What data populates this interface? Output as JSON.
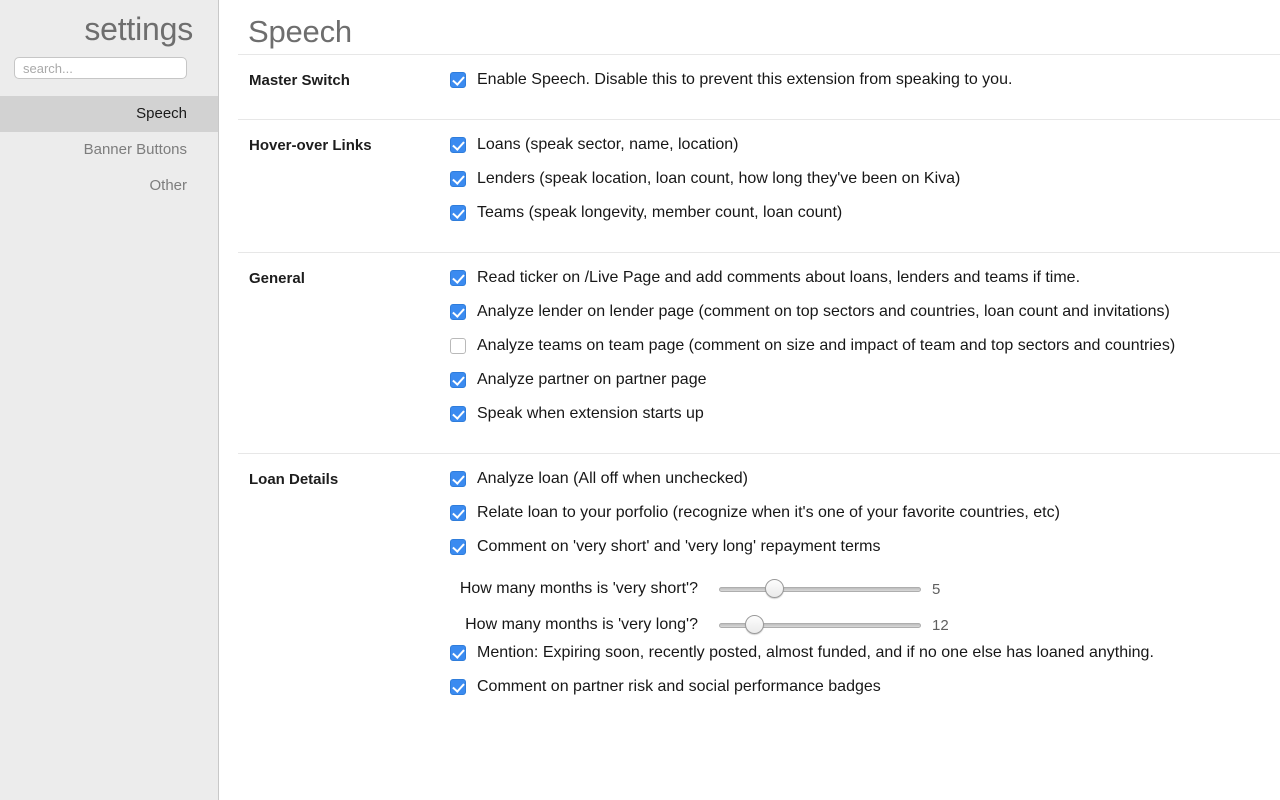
{
  "sidebar": {
    "title": "settings",
    "search": {
      "placeholder": "search...",
      "value": ""
    },
    "items": [
      {
        "label": "Speech",
        "selected": true
      },
      {
        "label": "Banner Buttons",
        "selected": false
      },
      {
        "label": "Other",
        "selected": false
      }
    ]
  },
  "main": {
    "title": "Speech",
    "sections": [
      {
        "label": "Master Switch",
        "rows": [
          {
            "kind": "checkbox",
            "checked": true,
            "label": "Enable Speech. Disable this to prevent this extension from speaking to you."
          }
        ]
      },
      {
        "label": "Hover-over Links",
        "rows": [
          {
            "kind": "checkbox",
            "checked": true,
            "label": "Loans (speak sector, name, location)"
          },
          {
            "kind": "checkbox",
            "checked": true,
            "label": "Lenders (speak location, loan count, how long they've been on Kiva)"
          },
          {
            "kind": "checkbox",
            "checked": true,
            "label": "Teams (speak longevity, member count, loan count)"
          }
        ]
      },
      {
        "label": "General",
        "rows": [
          {
            "kind": "checkbox",
            "checked": true,
            "label": "Read ticker on /Live Page and add comments about loans, lenders and teams if time."
          },
          {
            "kind": "checkbox",
            "checked": true,
            "label": "Analyze lender on lender page (comment on top sectors and countries, loan count and invitations)"
          },
          {
            "kind": "checkbox",
            "checked": false,
            "label": "Analyze teams on team page (comment on size and impact of team and top sectors and countries)"
          },
          {
            "kind": "checkbox",
            "checked": true,
            "label": "Analyze partner on partner page"
          },
          {
            "kind": "checkbox",
            "checked": true,
            "label": "Speak when extension starts up"
          }
        ]
      },
      {
        "label": "Loan Details",
        "rows": [
          {
            "kind": "checkbox",
            "checked": true,
            "label": "Analyze loan (All off when unchecked)"
          },
          {
            "kind": "checkbox",
            "checked": true,
            "label": "Relate loan to your porfolio (recognize when it's one of your favorite countries, etc)"
          },
          {
            "kind": "checkbox",
            "checked": true,
            "label": "Comment on 'very short' and 'very long' repayment terms"
          },
          {
            "kind": "slider",
            "label": "How many months is 'very short'?",
            "value": "5",
            "percent": 25
          },
          {
            "kind": "slider",
            "label": "How many months is 'very long'?",
            "value": "12",
            "percent": 14
          },
          {
            "kind": "checkbox",
            "checked": true,
            "label": "Mention: Expiring soon, recently posted, almost funded, and if no one else has loaned anything."
          },
          {
            "kind": "checkbox",
            "checked": true,
            "label": "Comment on partner risk and social performance badges"
          }
        ]
      }
    ]
  },
  "colors": {
    "checkbox_on": "#3b8bf0",
    "sidebar_bg": "#ececec",
    "sidebar_selected_bg": "#d2d2d2",
    "title_text": "#6e6e6e"
  }
}
